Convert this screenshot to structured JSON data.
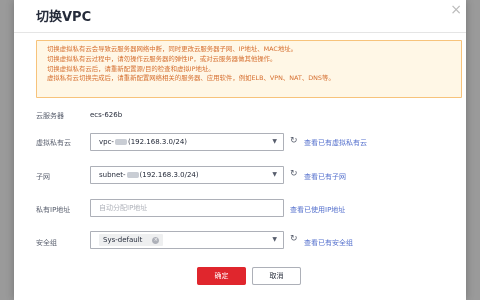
{
  "dialog": {
    "title": "切换VPC",
    "warnings": [
      "切换虚拟私有云会导致云服务器网络中断，同时更改云服务器子网、IP地址、MAC地址。",
      "切换虚拟私有云过程中，请勿操作云服务器的弹性IP，或对云服务器做其他操作。",
      "切换虚拟私有云后，请重新配置源/目的检查和虚拟IP地址。",
      "虚拟私有云切换完成后，请重新配置网络相关的服务器、应用软件，例如ELB、VPN、NAT、DNS等。"
    ]
  },
  "form": {
    "server_label": "云服务器",
    "server_value": "ecs-626b",
    "vpc_label": "虚拟私有云",
    "vpc_prefix": "vpc-",
    "vpc_cidr": "(192.168.3.0/24)",
    "vpc_link": "查看已有虚拟私有云",
    "subnet_label": "子网",
    "subnet_prefix": "subnet-",
    "subnet_cidr": "(192.168.3.0/24)",
    "subnet_link": "查看已有子网",
    "ip_label": "私有IP地址",
    "ip_placeholder": "自动分配IP地址",
    "ip_link": "查看已使用IP地址",
    "sg_label": "安全组",
    "sg_tag": "Sys-default",
    "sg_link": "查看已有安全组"
  },
  "buttons": {
    "ok": "确定",
    "cancel": "取消"
  },
  "colors": {
    "primary": "#e0262d",
    "link": "#526ecc",
    "warning_text": "#d56d2d",
    "warning_bg": "#fff7e6"
  },
  "icons": [
    "close-icon",
    "chevron-down-icon",
    "refresh-icon",
    "tag-close-icon"
  ]
}
